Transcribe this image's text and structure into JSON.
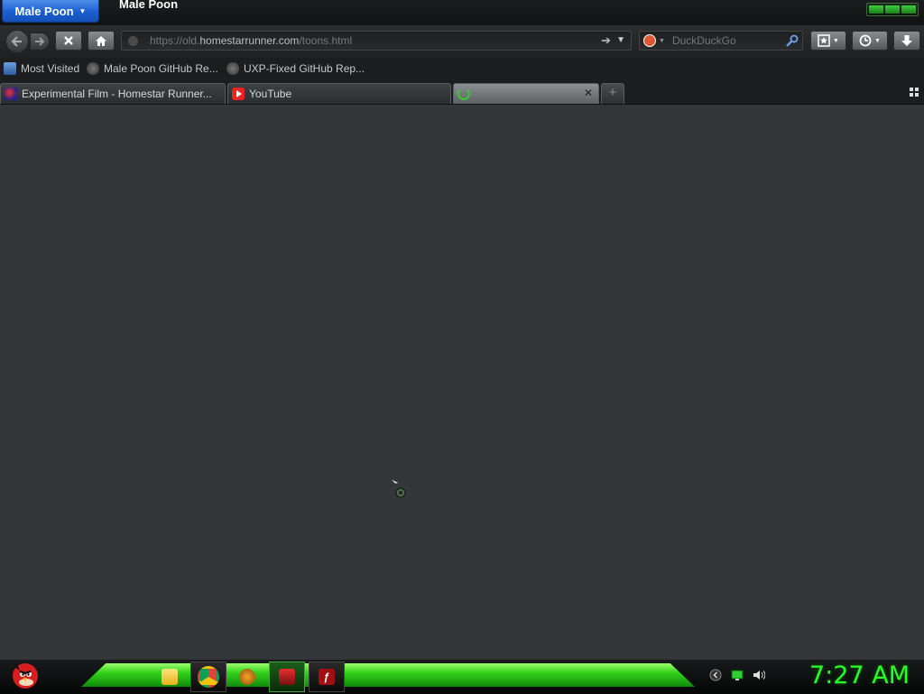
{
  "window": {
    "app_button_label": "Male Poon",
    "title": "Male Poon"
  },
  "navbar": {
    "url_prefix": "https://old.",
    "url_host": "homestarrunner.com",
    "url_path": "/toons.html",
    "search_placeholder": "DuckDuckGo"
  },
  "bookmarks": [
    {
      "label": "Most Visited",
      "icon": "most-visited-icon"
    },
    {
      "label": "Male Poon GitHub Re...",
      "icon": "globe-icon"
    },
    {
      "label": "UXP-Fixed GitHub Rep...",
      "icon": "globe-icon"
    }
  ],
  "tabs": [
    {
      "label": "Experimental Film - Homestar Runner...",
      "icon": "homestar-runner-icon",
      "active": false
    },
    {
      "label": "YouTube",
      "icon": "youtube-icon",
      "active": false
    },
    {
      "label": "",
      "icon": "loading-spinner-icon",
      "active": true
    }
  ],
  "taskbar": {
    "clock": "7:27 AM",
    "apps": [
      "file-manager-icon",
      "chrome-icon",
      "bird-app-icon",
      "game-app-icon",
      "flash-icon"
    ],
    "accent_color": "#2bff2b"
  }
}
